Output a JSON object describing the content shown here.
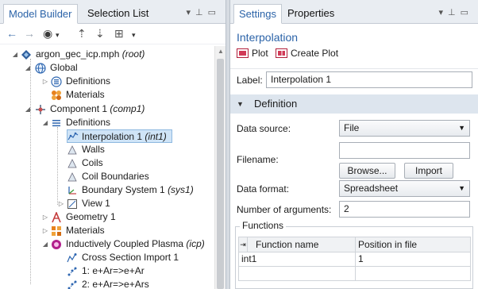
{
  "left": {
    "tabs": {
      "model_builder": "Model Builder",
      "selection_list": "Selection List"
    },
    "tree": {
      "root": {
        "name": "argon_gec_icp.mph",
        "tag": "(root)"
      },
      "global": "Global",
      "global_definitions": "Definitions",
      "global_materials": "Materials",
      "component": {
        "name": "Component 1",
        "tag": "(comp1)"
      },
      "definitions": "Definitions",
      "interpolation": {
        "name": "Interpolation 1",
        "tag": "(int1)"
      },
      "walls": "Walls",
      "coils": "Coils",
      "coil_boundaries": "Coil Boundaries",
      "boundary_system": {
        "name": "Boundary System 1",
        "tag": "(sys1)"
      },
      "view": "View 1",
      "geometry": "Geometry 1",
      "materials": "Materials",
      "icp": {
        "name": "Inductively Coupled Plasma",
        "tag": "(icp)"
      },
      "cross_section": "Cross Section Import 1",
      "reaction1": "1: e+Ar=>e+Ar",
      "reaction2": "2: e+Ar=>e+Ars"
    }
  },
  "right": {
    "tabs": {
      "settings": "Settings",
      "properties": "Properties"
    },
    "title": "Interpolation",
    "plot_label": "Plot",
    "create_plot_label": "Create Plot",
    "label_caption": "Label:",
    "label_value": "Interpolation 1",
    "section_title": "Definition",
    "data_source": {
      "caption": "Data source:",
      "value": "File"
    },
    "filename": {
      "caption": "Filename:",
      "value": ""
    },
    "browse_label": "Browse...",
    "import_label": "Import",
    "data_format": {
      "caption": "Data format:",
      "value": "Spreadsheet"
    },
    "num_args": {
      "caption": "Number of arguments:",
      "value": "2"
    },
    "functions": {
      "title": "Functions",
      "headers": [
        "Function name",
        "Position in file"
      ],
      "rows": [
        {
          "name": "int1",
          "position": "1"
        },
        {
          "name": "",
          "position": ""
        }
      ]
    }
  },
  "colors": {
    "accent": "#2b63a8",
    "selection": "#cfe4f7",
    "section_bg": "#dde5ee"
  }
}
